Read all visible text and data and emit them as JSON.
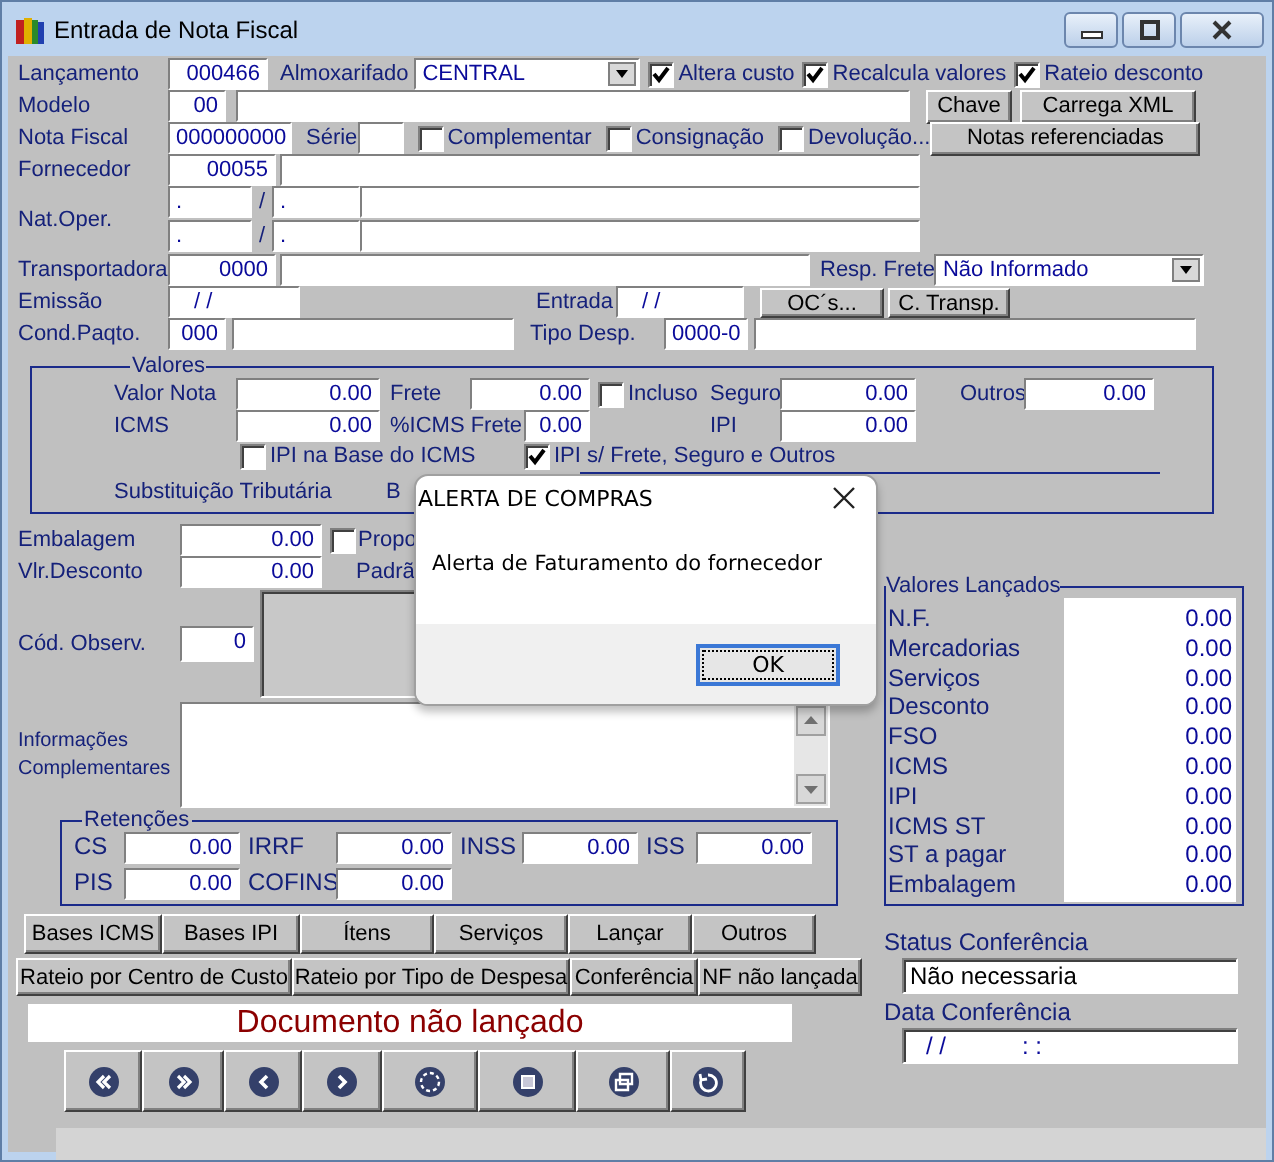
{
  "window": {
    "title": "Entrada de Nota Fiscal"
  },
  "header": {
    "lancamento": {
      "label": "Lançamento",
      "value": "000466"
    },
    "almoxarifado": {
      "label": "Almoxarifado",
      "value": "CENTRAL"
    },
    "flags": [
      {
        "label": "Altera custo",
        "checked": true
      },
      {
        "label": "Recalcula valores",
        "checked": true
      },
      {
        "label": "Rateio desconto",
        "checked": true
      }
    ],
    "modelo": {
      "label": "Modelo",
      "code": "00"
    },
    "xml_buttons": [
      "Chave",
      "Carrega XML"
    ],
    "nota_fiscal": {
      "label": "Nota Fiscal",
      "value": "000000000"
    },
    "serie": {
      "label": "Série"
    },
    "nf_types": [
      {
        "label": "Complementar",
        "checked": false
      },
      {
        "label": "Consignação",
        "checked": false
      },
      {
        "label": "Devolução...",
        "checked": false
      }
    ],
    "notas_button": "Notas referenciadas",
    "fornecedor": {
      "label": "Fornecedor",
      "code": "00055"
    },
    "nat_oper": {
      "label": "Nat.Oper.",
      "lines": [
        {
          "cfop": ".",
          "separator": "/",
          "cfop_2": "."
        },
        {
          "cfop": ".",
          "separator": "/",
          "cfop_2": "."
        }
      ]
    },
    "transportadora": {
      "label": "Transportadora",
      "code": "0000"
    },
    "resp_frete": {
      "label": "Resp. Frete",
      "value": "Não Informado"
    },
    "emissao": {
      "label": "Emissão",
      "value": "/ /"
    },
    "entrada": {
      "label": "Entrada",
      "value": "/ /"
    },
    "date_buttons": [
      "OC´s...",
      "C. Transp."
    ],
    "cond_pagto": {
      "label": "Cond.Paqto.",
      "code": "000"
    },
    "tipo_desp": {
      "label": "Tipo Desp.",
      "code": "0000-0"
    }
  },
  "valores": {
    "title": "Valores",
    "valor_nota": {
      "label": "Valor Nota",
      "value": "0.00"
    },
    "frete": {
      "label": "Frete",
      "value": "0.00"
    },
    "incluso": {
      "label": "Incluso",
      "checked": false
    },
    "seguro": {
      "label": "Seguro",
      "value": "0.00"
    },
    "outros": {
      "label": "Outros",
      "value": "0.00"
    },
    "icms": {
      "label": "ICMS",
      "value": "0.00"
    },
    "icms_frete": {
      "label": "%ICMS Frete",
      "value": "0.00"
    },
    "ipi": {
      "label": "IPI",
      "value": "0.00"
    },
    "ipi_base_icms": {
      "label": "IPI na Base do ICMS",
      "checked": false
    },
    "ipi_frete": {
      "label": "IPI s/ Frete, Seguro e Outros",
      "checked": true
    },
    "substituicao": "Substituição Tributária",
    "column_2": "B"
  },
  "embalagem": {
    "label": "Embalagem",
    "value": "0.00"
  },
  "proporcional": {
    "label": "Propo",
    "checked": false
  },
  "vlr_desconto": {
    "label": "Vlr.Desconto",
    "value": "0.00"
  },
  "padrao_label": "Padrã",
  "observacao": {
    "label": "Cód. Observ.",
    "code": "0"
  },
  "informacoes": {
    "label": "Informações Complementares"
  },
  "retencoes": {
    "title": "Retenções",
    "fields": [
      {
        "label": "CS",
        "value": "0.00"
      },
      {
        "label": "IRRF",
        "value": "0.00"
      },
      {
        "label": "INSS",
        "value": "0.00"
      },
      {
        "label": "ISS",
        "value": "0.00"
      },
      {
        "label": "PIS",
        "value": "0.00"
      },
      {
        "label": "COFINS",
        "value": "0.00"
      }
    ]
  },
  "valores_lancados": {
    "title": "Valores Lançados",
    "rows": [
      {
        "label": "N.F.",
        "value": "0.00"
      },
      {
        "label": "Mercadorias",
        "value": "0.00"
      },
      {
        "label": "Serviços",
        "value": "0.00"
      },
      {
        "label": "Desconto",
        "value": "0.00"
      },
      {
        "label": "FSO",
        "value": "0.00"
      },
      {
        "label": "ICMS",
        "value": "0.00"
      },
      {
        "label": "IPI",
        "value": "0.00"
      },
      {
        "label": "ICMS ST",
        "value": "0.00"
      },
      {
        "label": "ST a  pagar",
        "value": "0.00"
      },
      {
        "label": "Embalagem",
        "value": "0.00"
      }
    ]
  },
  "status_conferencia": {
    "label": "Status Conferência",
    "value": "Não necessaria"
  },
  "data_conferencia": {
    "label": "Data Conferência",
    "date": "/ /",
    "time": ": :"
  },
  "action_buttons": [
    "Bases ICMS",
    "Bases IPI",
    "Ítens",
    "Serviços",
    "Lançar",
    "Outros"
  ],
  "rateio_buttons": [
    "Rateio por Centro de Custo",
    "Rateio por Tipo de Despesa",
    "Conferência",
    "NF não lançada"
  ],
  "document_status": "Documento não lançado",
  "nav_buttons": [
    {
      "kind": "first"
    },
    {
      "kind": "last"
    },
    {
      "kind": "prev"
    },
    {
      "kind": "next"
    },
    {
      "kind": "new"
    },
    {
      "kind": "delete"
    },
    {
      "kind": "copy"
    },
    {
      "kind": "undo"
    }
  ],
  "dialog": {
    "title": "ALERTA DE COMPRAS",
    "message": "Alerta de Faturamento do fornecedor",
    "button": "OK"
  }
}
